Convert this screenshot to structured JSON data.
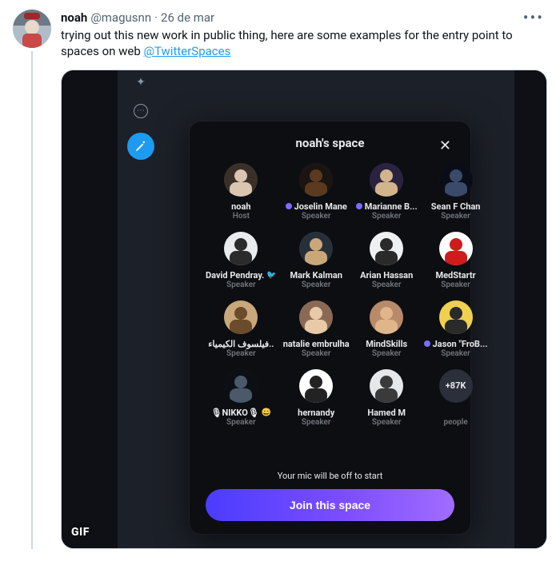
{
  "tweet": {
    "display_name": "noah",
    "handle": "@magusnn",
    "separator": "·",
    "date": "26 de mar",
    "text_prefix": "trying out this new work in public thing, here are some examples for the entry point to spaces on web ",
    "mention": "@TwitterSpaces",
    "gif_badge": "GIF"
  },
  "space": {
    "title": "noah's space",
    "close_label": "✕",
    "mic_note": "Your mic will be off to start",
    "join_label": "Join this space",
    "overflow": {
      "count_label": "+87K",
      "role": "people"
    },
    "participants": [
      {
        "name": "noah",
        "role": "Host",
        "dot": null,
        "avatar": {
          "bg": "#3b2f2a",
          "fg": "#d9c5b0"
        }
      },
      {
        "name": "Joselin Mane",
        "role": "Speaker",
        "dot": "#7c6cff",
        "avatar": {
          "bg": "#1a1510",
          "fg": "#5b3a1f"
        }
      },
      {
        "name": "Marianne B...",
        "role": "Speaker",
        "dot": "#7c6cff",
        "avatar": {
          "bg": "#2a2340",
          "fg": "#d3b58b"
        }
      },
      {
        "name": "Sean F Chan",
        "role": "Speaker",
        "dot": null,
        "avatar": {
          "bg": "#0a0d18",
          "fg": "#3a4a6a"
        }
      },
      {
        "name": "David Pendray.",
        "role": "Speaker",
        "dot": null,
        "emoji": "🐦",
        "avatar": {
          "bg": "#e9ebee",
          "fg": "#2b2b2b"
        }
      },
      {
        "name": "Mark Kalman",
        "role": "Speaker",
        "dot": null,
        "avatar": {
          "bg": "#27303a",
          "fg": "#caa77a"
        }
      },
      {
        "name": "Arian Hassan",
        "role": "Speaker",
        "dot": null,
        "avatar": {
          "bg": "#eef0f2",
          "fg": "#2a2a2a"
        }
      },
      {
        "name": "MedStartr",
        "role": "Speaker",
        "dot": null,
        "avatar": {
          "bg": "#ffffff",
          "fg": "#cf1b1b"
        }
      },
      {
        "name": "فيلسوف الكيمياء..",
        "role": "Speaker",
        "dot": null,
        "avatar": {
          "bg": "#caa77a",
          "fg": "#6a4b2a"
        }
      },
      {
        "name": "natalie embrulha",
        "role": "Speaker",
        "dot": null,
        "avatar": {
          "bg": "#8a6a55",
          "fg": "#e8c9a8"
        }
      },
      {
        "name": "MindSkills",
        "role": "Speaker",
        "dot": null,
        "avatar": {
          "bg": "#b78a6a",
          "fg": "#e0b58a"
        }
      },
      {
        "name": "Jason \"FroB...",
        "role": "Speaker",
        "dot": "#7c6cff",
        "avatar": {
          "bg": "#f0d050",
          "fg": "#2a2a2a"
        }
      },
      {
        "name": "🎙NIKKO🎙",
        "role": "Speaker",
        "dot": null,
        "emoji": "😄",
        "avatar": {
          "bg": "#0c0f14",
          "fg": "#4a5a6a"
        }
      },
      {
        "name": "hernandy",
        "role": "Speaker",
        "dot": null,
        "avatar": {
          "bg": "#ffffff",
          "fg": "#222"
        }
      },
      {
        "name": "Hamed M",
        "role": "Speaker",
        "dot": null,
        "avatar": {
          "bg": "#e5e7ea",
          "fg": "#3a3a3a"
        }
      }
    ]
  }
}
